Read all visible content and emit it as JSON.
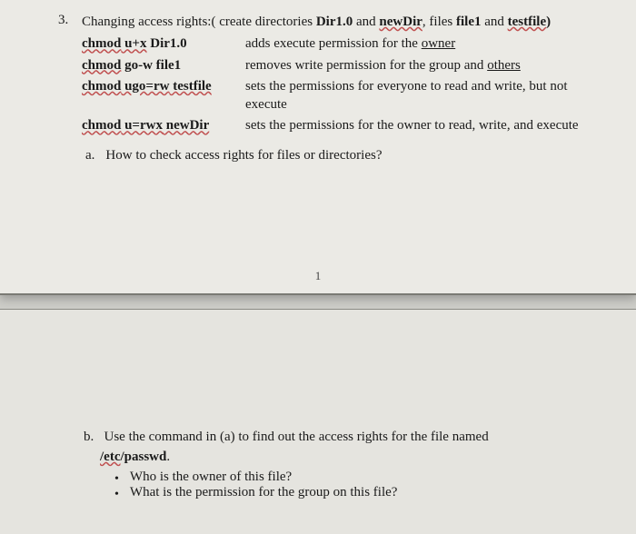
{
  "item_number": "3.",
  "heading": {
    "pre": "Changing access rights:( create directories ",
    "dir1": "Dir1.0",
    "mid1": " and ",
    "dir2": "newDir",
    "mid2": ", files ",
    "file1": "file1",
    "mid3": " and ",
    "file2": "testfile",
    "end": ")"
  },
  "commands": [
    {
      "cmd_pre": "chmod",
      "cmd_arg1": " u+x",
      "cmd_arg2": " Dir1.0",
      "desc_pre": "adds execute permission for the ",
      "desc_u": "owner",
      "desc_post": ""
    },
    {
      "cmd_pre": "chmod",
      "cmd_arg1": " go-w ",
      "cmd_arg2": "file1",
      "desc_pre": "removes write permission for the group and ",
      "desc_u": "others",
      "desc_post": ""
    },
    {
      "cmd_pre": "chmod",
      "cmd_arg1": " ugo=rw",
      "cmd_arg2": " testfile",
      "desc_pre": "sets the permissions for everyone to read and write, but not execute",
      "desc_u": "",
      "desc_post": ""
    },
    {
      "cmd_pre": "chmod",
      "cmd_arg1": " u=rwx",
      "cmd_arg2": " newDir",
      "desc_pre": "sets the permissions for the owner to read, write, and execute",
      "desc_u": "",
      "desc_post": ""
    }
  ],
  "sub_a": {
    "label": "a.",
    "text": "How to check access rights for files or directories?"
  },
  "page_num": "1",
  "sub_b": {
    "label": "b.",
    "line1_pre": "Use the command in (a) to find out the access rights for the file named ",
    "path_seg1": "/etc",
    "path_seg2": "/passwd",
    "line1_post": "."
  },
  "bullets": [
    "Who is the owner of this file?",
    "What is the permission for the group on this file?"
  ]
}
